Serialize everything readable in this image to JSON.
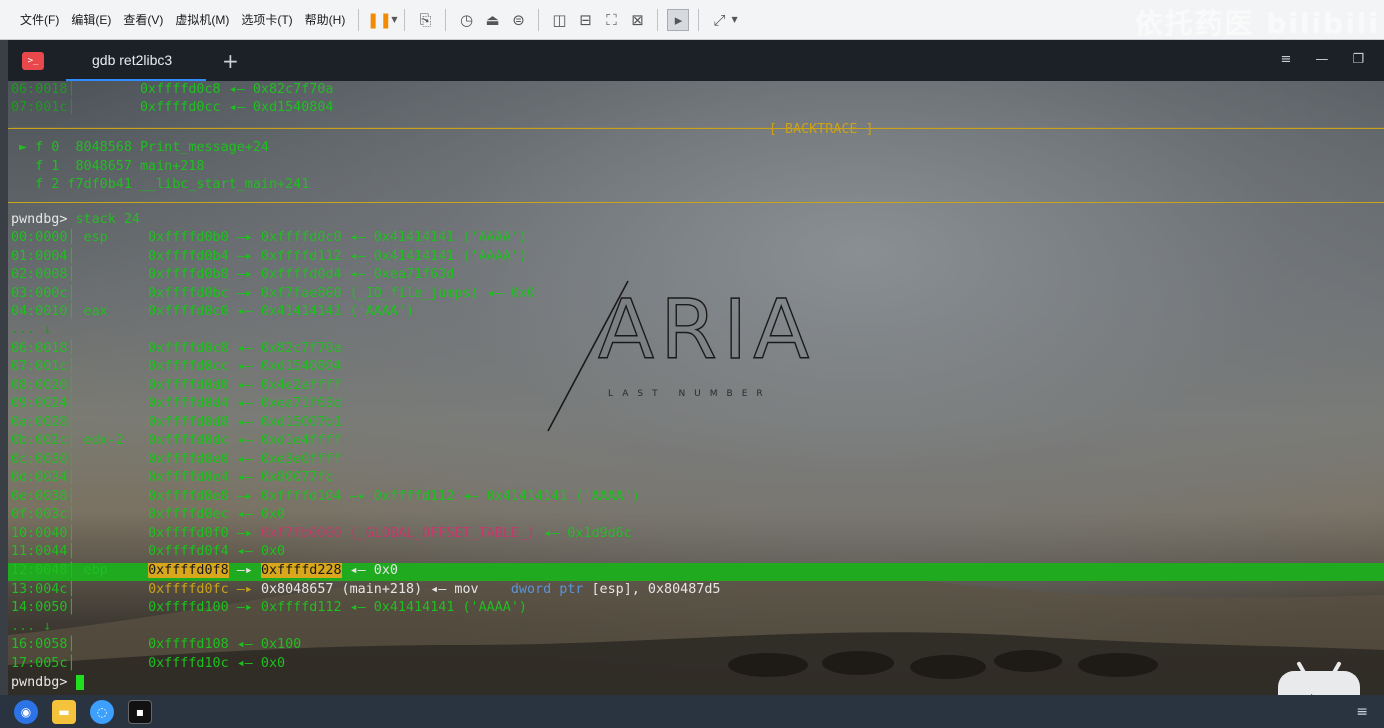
{
  "menubar": {
    "items": [
      "文件(F)",
      "编辑(E)",
      "查看(V)",
      "虚拟机(M)",
      "选项卡(T)",
      "帮助(H)"
    ],
    "watermark": "依托药医 bilibili"
  },
  "tabbar": {
    "tab_label": "gdb ret2libc3",
    "new_tab": "+",
    "window_controls": [
      "≡",
      "—",
      "❐"
    ]
  },
  "terminal": {
    "lines": [
      {
        "id": "l0",
        "segs": [
          [
            "06:0018│",
            "dim"
          ],
          [
            "        ",
            ""
          ],
          [
            "0xffffd0c8 ◂— 0x82c7f70a",
            "g"
          ]
        ]
      },
      {
        "id": "l1",
        "segs": [
          [
            "07:001c│",
            "dim"
          ],
          [
            "        ",
            ""
          ],
          [
            "0xffffd0cc ◂— 0xd1540804",
            "g"
          ]
        ]
      },
      {
        "id": "l2",
        "segs": [
          [
            "──────────────────────────────────────────────────────────────────────────────────────────────[ BACKTRACE ]──────────────────────────────────────────────────────────────────────────────────────────────────────────────────",
            "y"
          ]
        ]
      },
      {
        "id": "l3",
        "segs": [
          [
            " ► f 0  8048568 Print_message+24",
            "g"
          ]
        ]
      },
      {
        "id": "l4",
        "segs": [
          [
            "   f 1  8048657 main+218",
            "g"
          ]
        ]
      },
      {
        "id": "l5",
        "segs": [
          [
            "   f 2 f7df0b41 __libc_start_main+241",
            "g"
          ]
        ]
      },
      {
        "id": "l6",
        "segs": [
          [
            "",
            "g"
          ]
        ]
      },
      {
        "id": "l7",
        "segs": [
          [
            "pwndbg> ",
            "w"
          ],
          [
            "stack 24",
            "g"
          ]
        ]
      },
      {
        "id": "l8",
        "segs": [
          [
            "00:0000│ esp     ",
            "g"
          ],
          [
            "0xffffd0b0 —▸ 0xffffd0c0 ◂— 0x41414141 ('AAAA')",
            "g"
          ]
        ]
      },
      {
        "id": "l9",
        "segs": [
          [
            "01:0004│         ",
            "g"
          ],
          [
            "0xffffd0b4 —▸ 0xffffd112 ◂— 0x41414141 ('AAAA')",
            "g"
          ]
        ]
      },
      {
        "id": "l10",
        "segs": [
          [
            "02:0008│         ",
            "g"
          ],
          [
            "0xffffd0b8 —▸ 0xffffd0d4 ◂— 0xea71f63d",
            "g"
          ]
        ]
      },
      {
        "id": "l11",
        "segs": [
          [
            "03:000c│         ",
            "g"
          ],
          [
            "0xffffd0bc —▸ 0xf7fae860 (_IO_file_jumps) ◂— 0x0",
            "g"
          ]
        ]
      },
      {
        "id": "l12",
        "segs": [
          [
            "04:0010│ eax     ",
            "g"
          ],
          [
            "0xffffd0c0 ◂— 0x41414141 ('AAAA')",
            "g"
          ]
        ]
      },
      {
        "id": "l13",
        "segs": [
          [
            "... ↓",
            "dim"
          ]
        ]
      },
      {
        "id": "l14",
        "segs": [
          [
            "06:0018│         ",
            "g"
          ],
          [
            "0xffffd0c8 ◂— 0x82c7f70a",
            "g"
          ]
        ]
      },
      {
        "id": "l15",
        "segs": [
          [
            "07:001c│         ",
            "g"
          ],
          [
            "0xffffd0cc ◂— 0xd1540804",
            "g"
          ]
        ]
      },
      {
        "id": "l16",
        "segs": [
          [
            "08:0020│         ",
            "g"
          ],
          [
            "0xffffd0d0 ◂— 0x4e2affff",
            "g"
          ]
        ]
      },
      {
        "id": "l17",
        "segs": [
          [
            "09:0024│         ",
            "g"
          ],
          [
            "0xffffd0d4 ◂— 0xea71f63d",
            "g"
          ]
        ]
      },
      {
        "id": "l18",
        "segs": [
          [
            "0a:0028│         ",
            "g"
          ],
          [
            "0xffffd0d8 ◂— 0xd15007b1",
            "g"
          ]
        ]
      },
      {
        "id": "l19",
        "segs": [
          [
            "0b:002c│ edx-2   ",
            "g"
          ],
          [
            "0xffffd0dc ◂— 0xd1e4ffff",
            "g"
          ]
        ]
      },
      {
        "id": "l20",
        "segs": [
          [
            "0c:0030│         ",
            "g"
          ],
          [
            "0xffffd0e0 ◂— 0xe3e0ffff",
            "g"
          ]
        ]
      },
      {
        "id": "l21",
        "segs": [
          [
            "0d:0034│         ",
            "g"
          ],
          [
            "0xffffd0e4 ◂— 0x80077fc",
            "g"
          ]
        ]
      },
      {
        "id": "l22",
        "segs": [
          [
            "0e:0038│         ",
            "g"
          ],
          [
            "0xffffd0e8 —▸ 0xffffd104 —▸ 0xffffd112 ◂— 0x41414141 ('AAAA')",
            "g"
          ]
        ]
      },
      {
        "id": "l23",
        "segs": [
          [
            "0f:003c│         ",
            "g"
          ],
          [
            "0xffffd0ec ◂— 0x0",
            "g"
          ]
        ]
      },
      {
        "id": "l24",
        "segs": [
          [
            "10:0040│         ",
            "g"
          ],
          [
            "0xffffd0f0 —▸ ",
            "g"
          ],
          [
            "0xf7fb0000 (_GLOBAL_OFFSET_TABLE_)",
            "r"
          ],
          [
            " ◂— 0x1d9d6c",
            "g"
          ]
        ]
      },
      {
        "id": "l25",
        "segs": [
          [
            "11:0044│         ",
            "g"
          ],
          [
            "0xffffd0f4 ◂— 0x0",
            "g"
          ]
        ]
      },
      {
        "id": "l26",
        "segs": [
          [
            "12:0048│ ebp     ",
            "g"
          ],
          [
            "0xffffd0f8",
            "hl"
          ],
          [
            " —▸ ",
            "w"
          ],
          [
            "0xffffd228",
            "hl"
          ],
          [
            " ◂— 0x0",
            "w"
          ]
        ]
      },
      {
        "id": "l27",
        "segs": [
          [
            "13:004c│         ",
            "g"
          ],
          [
            "0xffffd0fc —▸ ",
            "y"
          ],
          [
            "0x8048657 (main+218) ◂— mov    ",
            "w"
          ],
          [
            "dword ptr ",
            "c"
          ],
          [
            "[esp]",
            "w"
          ],
          [
            ", 0x80487d5",
            "w"
          ]
        ]
      },
      {
        "id": "l28",
        "segs": [
          [
            "14:0050│         ",
            "g"
          ],
          [
            "0xffffd100 —▸ 0xffffd112 ◂— 0x41414141 ('AAAA')",
            "g"
          ]
        ]
      },
      {
        "id": "l29",
        "segs": [
          [
            "... ↓",
            "dim"
          ]
        ]
      },
      {
        "id": "l30",
        "segs": [
          [
            "16:0058│         ",
            "g"
          ],
          [
            "0xffffd108 ◂— 0x100",
            "g"
          ]
        ]
      },
      {
        "id": "l31",
        "segs": [
          [
            "17:005c│         ",
            "g"
          ],
          [
            "0xffffd10c ◂— 0x0",
            "g"
          ]
        ]
      },
      {
        "id": "l32",
        "segs": [
          [
            "pwndbg> ",
            "w"
          ]
        ]
      }
    ],
    "logo_text": "ARIA",
    "logo_sub": "LAST NUMBER"
  },
  "icons": {
    "terminal_app": "terminal-icon",
    "play": "bilibili-play-icon"
  },
  "colors": {
    "prompt_green": "#1fbf1f",
    "highlight_yellow": "#d8a71c",
    "rule_gold": "#c8a51b",
    "got_magenta": "#c23a6b"
  }
}
